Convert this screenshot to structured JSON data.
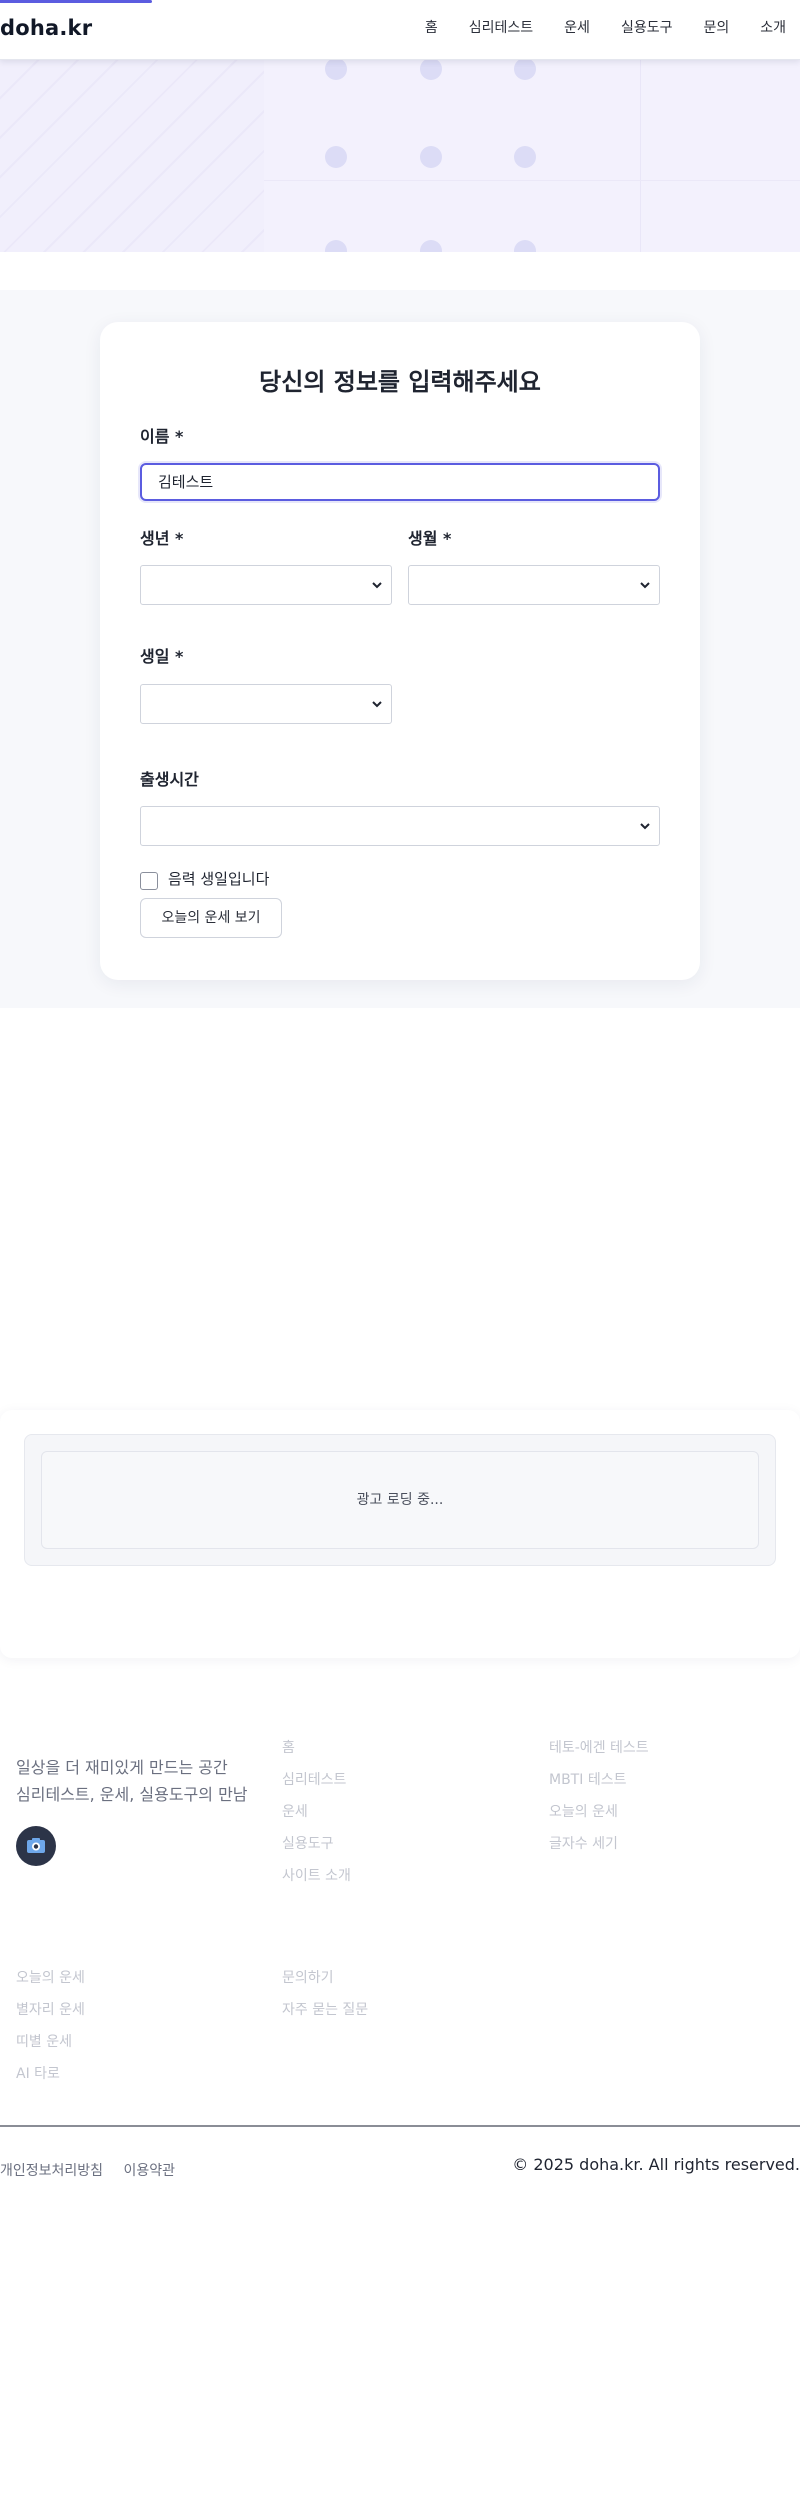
{
  "header": {
    "logo": "doha.kr",
    "nav": [
      "홈",
      "심리테스트",
      "운세",
      "실용도구",
      "문의",
      "소개"
    ],
    "progress_fraction": 0.19
  },
  "form": {
    "title": "당신의 정보를 입력해주세요",
    "name_label": "이름 *",
    "name_value": "김테스트",
    "year_label": "생년 *",
    "month_label": "생월 *",
    "day_label": "생일 *",
    "time_label": "출생시간",
    "year_value": "",
    "month_value": "",
    "day_value": "",
    "time_value": "",
    "lunar_label": "음력 생일입니다",
    "lunar_checked": false,
    "submit_label": "오늘의 운세 보기"
  },
  "ad": {
    "loading_text": "광고 로딩 중..."
  },
  "footer": {
    "tagline_line1": "일상을 더 재미있게 만드는 공간",
    "tagline_line2": "심리테스트, 운세, 실용도구의 만남",
    "social_icon": "camera-icon",
    "col1": [
      "홈",
      "심리테스트",
      "운세",
      "실용도구",
      "사이트 소개"
    ],
    "col2": [
      "테토-에겐 테스트",
      "MBTI 테스트",
      "오늘의 운세",
      "글자수 세기"
    ],
    "col3": [
      "오늘의 운세",
      "별자리 운세",
      "띠별 운세",
      "AI 타로"
    ],
    "col4": [
      "문의하기",
      "자주 묻는 질문"
    ],
    "bottom_links": [
      "개인정보처리방침",
      "이용약관"
    ],
    "copyright": "© 2025 doha.kr. All rights reserved."
  },
  "colors": {
    "accent": "#5b5ce0",
    "hero_bg": "#f3f1fd",
    "band_bg": "#f7f8fb"
  }
}
